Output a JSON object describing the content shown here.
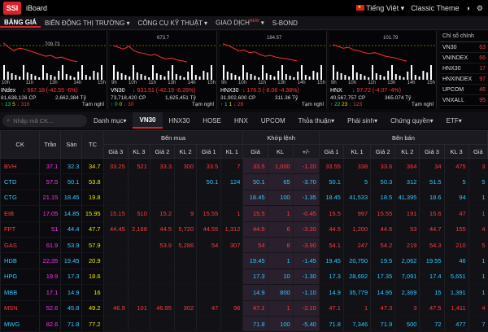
{
  "topbar": {
    "logo": "SSI",
    "app": "iBoard",
    "language": "Tiếng Việt",
    "theme": "Classic Theme"
  },
  "menu": [
    {
      "label": "BẢNG GIÁ"
    },
    {
      "label": "BIẾN ĐỘNG THỊ TRƯỜNG"
    },
    {
      "label": "CÔNG CỤ KỸ THUẬT"
    },
    {
      "label": "GIAO DỊCH",
      "badge": "NEW"
    },
    {
      "label": "S-BOND"
    }
  ],
  "charts": [
    {
      "name": "INdex",
      "ref": "709.73",
      "change": "↓ 667.18 (-42.55 -6%)",
      "vol": "81,638,126 CP",
      "val": "2,662,384 Tỷ",
      "up": "↑ 13",
      "ref_count": "5",
      "down": "↓ 316",
      "status": "Tạm nghỉ",
      "times": [
        "10h",
        "11h",
        "13h",
        "14h",
        "15h"
      ]
    },
    {
      "name": "VN30",
      "ref": "673.7",
      "change": "↓ 631.51 (-42.19 -6.26%)",
      "vol": "73,718,420 CP",
      "val": "1,625,451 Tỷ",
      "up": "↑ 0",
      "ref_count": "0",
      "down": "↓ 30",
      "status": "Tạm nghỉ",
      "times": [
        "9h",
        "10h",
        "11h",
        "13h",
        "14h",
        "15h"
      ]
    },
    {
      "name": "HNX30",
      "ref": "184.57",
      "change": "↓ 176.5 (-8.08 -4.38%)",
      "vol": "31,902,600 CP",
      "val": "311.36 Tỷ",
      "up": "↑ 1",
      "ref_count": "1",
      "down": "↓ 28",
      "status": "Tạm nghỉ",
      "times": [
        "9h",
        "10h",
        "11h",
        "13h",
        "14h",
        "15h"
      ]
    },
    {
      "name": "HNX",
      "ref": "101.79",
      "change": "↓ 97.72 (-4.07 -4%)",
      "vol": "40,567,757 CP",
      "val": "365.074 Tỷ",
      "up": "↑ 22",
      "ref_count": "23",
      "down": "↓ 123",
      "status": "Tạm nghỉ",
      "times": [
        "9h",
        "10h",
        "11h",
        "13h",
        "14h",
        "15h"
      ]
    }
  ],
  "index_panel": {
    "title": "Chỉ số chính",
    "items": [
      {
        "name": "VN30",
        "value": "63"
      },
      {
        "name": "VNINDEX",
        "value": "66"
      },
      {
        "name": "HNX30",
        "value": "17"
      },
      {
        "name": "HNXINDEX",
        "value": "97"
      },
      {
        "name": "UPCOM",
        "value": "46"
      },
      {
        "name": "VNXALL",
        "value": "95"
      }
    ]
  },
  "search": {
    "placeholder": "Nhập mã CK..."
  },
  "tabs": [
    "Danh mục",
    "VN30",
    "HNX30",
    "HOSE",
    "HNX",
    "UPCOM",
    "Thỏa thuận",
    "Phái sinh",
    "Chứng quyền",
    "ETF"
  ],
  "table": {
    "groups": {
      "buy": "Bên mua",
      "match": "Khớp lệnh",
      "sell": "Bên bán"
    },
    "cols": [
      "CK",
      "Trần",
      "Sàn",
      "TC",
      "Giá 3",
      "KL 3",
      "Giá 2",
      "KL 2",
      "Giá 1",
      "KL 1",
      "Giá",
      "KL",
      "+/-",
      "Giá 1",
      "KL 1",
      "Giá 2",
      "KL 2",
      "Giá 3",
      "KL 3",
      "Giá"
    ],
    "rows": [
      {
        "ck": "BVH",
        "ceil": "37.1",
        "floor": "32.3",
        "ref": "34.7",
        "b3": "33.25",
        "k3": "521",
        "b2": "33.3",
        "k2": "300",
        "b1": "33.5",
        "k1": "7",
        "p": "33.5",
        "kl": "1,000",
        "chg": "-1.20",
        "s1": "33.55",
        "sk1": "338",
        "s2": "33.6",
        "sk2": "364",
        "s3": "34",
        "sk3": "475",
        "g": "3",
        "cls": "r"
      },
      {
        "ck": "CTD",
        "ceil": "57.5",
        "floor": "50.1",
        "ref": "53.8",
        "b3": "",
        "k3": "",
        "b2": "",
        "k2": "",
        "b1": "50.1",
        "k1": "124",
        "p": "50.1",
        "kl": "65",
        "chg": "-3.70",
        "s1": "50.1",
        "sk1": "5",
        "s2": "50.3",
        "sk2": "312",
        "s3": "51.5",
        "sk3": "5",
        "g": "5",
        "cls": "c"
      },
      {
        "ck": "CTG",
        "ceil": "21.15",
        "floor": "18.45",
        "ref": "19.8",
        "b3": "",
        "k3": "",
        "b2": "",
        "k2": "",
        "b1": "",
        "k1": "",
        "p": "18.45",
        "kl": "100",
        "chg": "-1.35",
        "s1": "18.45",
        "sk1": "41,533",
        "s2": "18.5",
        "sk2": "41,395",
        "s3": "18.6",
        "sk3": "94",
        "g": "1",
        "cls": "c"
      },
      {
        "ck": "EIB",
        "ceil": "17.05",
        "floor": "14.85",
        "ref": "15.95",
        "b3": "15.15",
        "k3": "510",
        "b2": "15.2",
        "k2": "9",
        "b1": "15.55",
        "k1": "1",
        "p": "15.5",
        "kl": "1",
        "chg": "-0.45",
        "s1": "15.5",
        "sk1": "997",
        "s2": "15.55",
        "sk2": "191",
        "s3": "15.6",
        "sk3": "47",
        "g": "1",
        "cls": "r"
      },
      {
        "ck": "FPT",
        "ceil": "51",
        "floor": "44.4",
        "ref": "47.7",
        "b3": "44.45",
        "k3": "2,168",
        "b2": "44.5",
        "k2": "5,720",
        "b1": "44.55",
        "k1": "1,312",
        "p": "44.5",
        "kl": "6",
        "chg": "-3.20",
        "s1": "44.5",
        "sk1": "1,200",
        "s2": "44.6",
        "sk2": "53",
        "s3": "44.7",
        "sk3": "155",
        "g": "4",
        "cls": "r"
      },
      {
        "ck": "GAS",
        "ceil": "61.9",
        "floor": "53.9",
        "ref": "57.9",
        "b3": "",
        "k3": "",
        "b2": "53.9",
        "k2": "5,286",
        "b1": "54",
        "k1": "307",
        "p": "54",
        "kl": "8",
        "chg": "-3.90",
        "s1": "54.1",
        "sk1": "247",
        "s2": "54.2",
        "sk2": "219",
        "s3": "54.3",
        "sk3": "210",
        "g": "5",
        "cls": "r"
      },
      {
        "ck": "HDB",
        "ceil": "22.35",
        "floor": "19.45",
        "ref": "20.9",
        "b3": "",
        "k3": "",
        "b2": "",
        "k2": "",
        "b1": "",
        "k1": "",
        "p": "19.45",
        "kl": "1",
        "chg": "-1.45",
        "s1": "19.45",
        "sk1": "20,750",
        "s2": "19.5",
        "sk2": "2,062",
        "s3": "19.55",
        "sk3": "46",
        "g": "1",
        "cls": "c"
      },
      {
        "ck": "HPG",
        "ceil": "19.9",
        "floor": "17.3",
        "ref": "18.6",
        "b3": "",
        "k3": "",
        "b2": "",
        "k2": "",
        "b1": "",
        "k1": "",
        "p": "17.3",
        "kl": "10",
        "chg": "-1.30",
        "s1": "17.3",
        "sk1": "28,692",
        "s2": "17.35",
        "sk2": "7,091",
        "s3": "17.4",
        "sk3": "5,651",
        "g": "1",
        "cls": "c"
      },
      {
        "ck": "MBB",
        "ceil": "17.1",
        "floor": "14.9",
        "ref": "16",
        "b3": "",
        "k3": "",
        "b2": "",
        "k2": "",
        "b1": "",
        "k1": "",
        "p": "14.9",
        "kl": "800",
        "chg": "-1.10",
        "s1": "14.9",
        "sk1": "35,779",
        "s2": "14.95",
        "sk2": "2,369",
        "s3": "15",
        "sk3": "1,391",
        "g": "1",
        "cls": "c"
      },
      {
        "ck": "MSN",
        "ceil": "52.6",
        "floor": "45.8",
        "ref": "49.2",
        "b3": "46.9",
        "k3": "101",
        "b2": "46.95",
        "k2": "302",
        "b1": "47",
        "k1": "96",
        "p": "47.1",
        "kl": "1",
        "chg": "-2.10",
        "s1": "47.1",
        "sk1": "1",
        "s2": "47.3",
        "sk2": "3",
        "s3": "47.5",
        "sk3": "1,411",
        "g": "4",
        "cls": "r"
      },
      {
        "ck": "MWG",
        "ceil": "82.6",
        "floor": "71.8",
        "ref": "77.2",
        "b3": "",
        "k3": "",
        "b2": "",
        "k2": "",
        "b1": "",
        "k1": "",
        "p": "71.8",
        "kl": "100",
        "chg": "-5.40",
        "s1": "71.8",
        "sk1": "7,346",
        "s2": "71.9",
        "sk2": "500",
        "s3": "72",
        "sk3": "477",
        "g": "7",
        "cls": "c"
      }
    ]
  }
}
